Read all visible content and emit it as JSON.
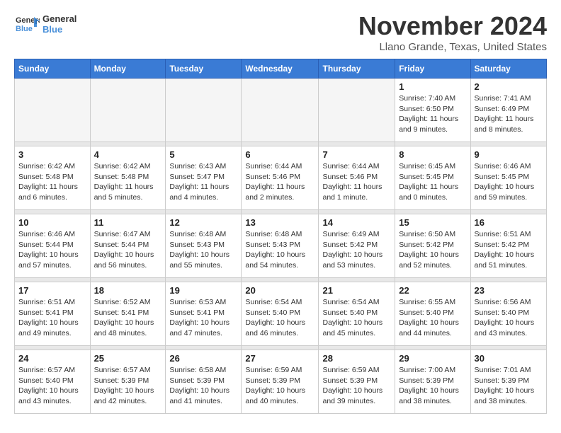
{
  "logo": {
    "text_general": "General",
    "text_blue": "Blue"
  },
  "header": {
    "month": "November 2024",
    "location": "Llano Grande, Texas, United States"
  },
  "weekdays": [
    "Sunday",
    "Monday",
    "Tuesday",
    "Wednesday",
    "Thursday",
    "Friday",
    "Saturday"
  ],
  "weeks": [
    [
      {
        "day": "",
        "info": ""
      },
      {
        "day": "",
        "info": ""
      },
      {
        "day": "",
        "info": ""
      },
      {
        "day": "",
        "info": ""
      },
      {
        "day": "",
        "info": ""
      },
      {
        "day": "1",
        "info": "Sunrise: 7:40 AM\nSunset: 6:50 PM\nDaylight: 11 hours and 9 minutes."
      },
      {
        "day": "2",
        "info": "Sunrise: 7:41 AM\nSunset: 6:49 PM\nDaylight: 11 hours and 8 minutes."
      }
    ],
    [
      {
        "day": "3",
        "info": "Sunrise: 6:42 AM\nSunset: 5:48 PM\nDaylight: 11 hours and 6 minutes."
      },
      {
        "day": "4",
        "info": "Sunrise: 6:42 AM\nSunset: 5:48 PM\nDaylight: 11 hours and 5 minutes."
      },
      {
        "day": "5",
        "info": "Sunrise: 6:43 AM\nSunset: 5:47 PM\nDaylight: 11 hours and 4 minutes."
      },
      {
        "day": "6",
        "info": "Sunrise: 6:44 AM\nSunset: 5:46 PM\nDaylight: 11 hours and 2 minutes."
      },
      {
        "day": "7",
        "info": "Sunrise: 6:44 AM\nSunset: 5:46 PM\nDaylight: 11 hours and 1 minute."
      },
      {
        "day": "8",
        "info": "Sunrise: 6:45 AM\nSunset: 5:45 PM\nDaylight: 11 hours and 0 minutes."
      },
      {
        "day": "9",
        "info": "Sunrise: 6:46 AM\nSunset: 5:45 PM\nDaylight: 10 hours and 59 minutes."
      }
    ],
    [
      {
        "day": "10",
        "info": "Sunrise: 6:46 AM\nSunset: 5:44 PM\nDaylight: 10 hours and 57 minutes."
      },
      {
        "day": "11",
        "info": "Sunrise: 6:47 AM\nSunset: 5:44 PM\nDaylight: 10 hours and 56 minutes."
      },
      {
        "day": "12",
        "info": "Sunrise: 6:48 AM\nSunset: 5:43 PM\nDaylight: 10 hours and 55 minutes."
      },
      {
        "day": "13",
        "info": "Sunrise: 6:48 AM\nSunset: 5:43 PM\nDaylight: 10 hours and 54 minutes."
      },
      {
        "day": "14",
        "info": "Sunrise: 6:49 AM\nSunset: 5:42 PM\nDaylight: 10 hours and 53 minutes."
      },
      {
        "day": "15",
        "info": "Sunrise: 6:50 AM\nSunset: 5:42 PM\nDaylight: 10 hours and 52 minutes."
      },
      {
        "day": "16",
        "info": "Sunrise: 6:51 AM\nSunset: 5:42 PM\nDaylight: 10 hours and 51 minutes."
      }
    ],
    [
      {
        "day": "17",
        "info": "Sunrise: 6:51 AM\nSunset: 5:41 PM\nDaylight: 10 hours and 49 minutes."
      },
      {
        "day": "18",
        "info": "Sunrise: 6:52 AM\nSunset: 5:41 PM\nDaylight: 10 hours and 48 minutes."
      },
      {
        "day": "19",
        "info": "Sunrise: 6:53 AM\nSunset: 5:41 PM\nDaylight: 10 hours and 47 minutes."
      },
      {
        "day": "20",
        "info": "Sunrise: 6:54 AM\nSunset: 5:40 PM\nDaylight: 10 hours and 46 minutes."
      },
      {
        "day": "21",
        "info": "Sunrise: 6:54 AM\nSunset: 5:40 PM\nDaylight: 10 hours and 45 minutes."
      },
      {
        "day": "22",
        "info": "Sunrise: 6:55 AM\nSunset: 5:40 PM\nDaylight: 10 hours and 44 minutes."
      },
      {
        "day": "23",
        "info": "Sunrise: 6:56 AM\nSunset: 5:40 PM\nDaylight: 10 hours and 43 minutes."
      }
    ],
    [
      {
        "day": "24",
        "info": "Sunrise: 6:57 AM\nSunset: 5:40 PM\nDaylight: 10 hours and 43 minutes."
      },
      {
        "day": "25",
        "info": "Sunrise: 6:57 AM\nSunset: 5:39 PM\nDaylight: 10 hours and 42 minutes."
      },
      {
        "day": "26",
        "info": "Sunrise: 6:58 AM\nSunset: 5:39 PM\nDaylight: 10 hours and 41 minutes."
      },
      {
        "day": "27",
        "info": "Sunrise: 6:59 AM\nSunset: 5:39 PM\nDaylight: 10 hours and 40 minutes."
      },
      {
        "day": "28",
        "info": "Sunrise: 6:59 AM\nSunset: 5:39 PM\nDaylight: 10 hours and 39 minutes."
      },
      {
        "day": "29",
        "info": "Sunrise: 7:00 AM\nSunset: 5:39 PM\nDaylight: 10 hours and 38 minutes."
      },
      {
        "day": "30",
        "info": "Sunrise: 7:01 AM\nSunset: 5:39 PM\nDaylight: 10 hours and 38 minutes."
      }
    ]
  ]
}
